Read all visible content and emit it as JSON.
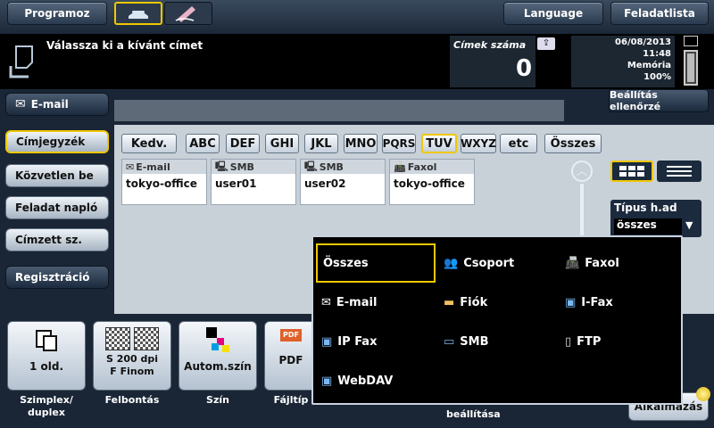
{
  "topbar": {
    "program_label": "Programoz",
    "language_label": "Language",
    "jobs_label": "Feladatlista"
  },
  "status": {
    "message": "Válassza ki a kívánt címet",
    "count_label": "Címek száma",
    "count_value": "0",
    "date": "06/08/2013",
    "time": "11:48",
    "memory_label": "Memória",
    "memory_value": "100%"
  },
  "left": {
    "email_label": "E-mail",
    "items": [
      "Címjegyzék",
      "Közvetlen be",
      "Feladat napló",
      "Címzett sz.",
      "Regisztráció"
    ]
  },
  "settings_check_label": "Beállítás ellenőrzé",
  "alpha_tabs": [
    "Kedv.",
    "ABC",
    "DEF",
    "GHI",
    "JKL",
    "MNO",
    "PQRS",
    "TUV",
    "WXYZ",
    "etc",
    "Összes"
  ],
  "cards": [
    {
      "type": "E-mail",
      "name": "tokyo-office"
    },
    {
      "type": "SMB",
      "name": "user01"
    },
    {
      "type": "SMB",
      "name": "user02"
    },
    {
      "type": "Faxol",
      "name": "tokyo-office"
    }
  ],
  "type_filter": {
    "label": "Típus h.ad",
    "value": "összes"
  },
  "popup_options": [
    {
      "label": "Összes",
      "icon": "none"
    },
    {
      "label": "Csoport",
      "icon": "group-icon"
    },
    {
      "label": "Faxol",
      "icon": "fax-icon"
    },
    {
      "label": "E-mail",
      "icon": "envelope-icon"
    },
    {
      "label": "Fiók",
      "icon": "box-icon"
    },
    {
      "label": "I-Fax",
      "icon": "ifax-icon"
    },
    {
      "label": "IP Fax",
      "icon": "ipfax-icon"
    },
    {
      "label": "SMB",
      "icon": "pc-icon"
    },
    {
      "label": "FTP",
      "icon": "ftp-icon"
    },
    {
      "label": "WebDAV",
      "icon": "webdav-icon"
    }
  ],
  "bottom": {
    "simplex": {
      "value": "1 old.",
      "label": "Szimplex/\nduplex"
    },
    "resolution": {
      "value": "S 200 dpi\nF Finom",
      "label": "Felbontás"
    },
    "color": {
      "value": "Autom.szín",
      "label": "Szín"
    },
    "filetype": {
      "value": "PDF",
      "label": "Fájltíp"
    },
    "partial_label": "beállítása",
    "start_label": "Alkalmazás"
  },
  "colors": {
    "accent_yellow": "#f0c800",
    "dark_bg": "#1a2636",
    "panel": "#c8d0d8"
  }
}
